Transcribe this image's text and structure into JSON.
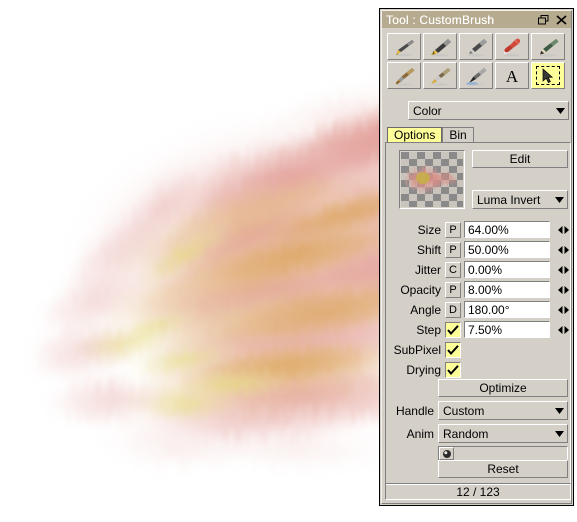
{
  "window": {
    "title": "Tool : CustomBrush",
    "restore_icon": "restore-icon",
    "close_icon": "close-icon"
  },
  "toolbar": {
    "rows": [
      [
        {
          "name": "tool-pen-nib",
          "icon": "pen-nib-icon",
          "selected": false
        },
        {
          "name": "tool-fountain-pen",
          "icon": "fountain-pen-icon",
          "selected": false
        },
        {
          "name": "tool-technical-pen",
          "icon": "technical-pen-icon",
          "selected": false
        },
        {
          "name": "tool-paintbrush",
          "icon": "paintbrush-icon",
          "selected": false
        },
        {
          "name": "tool-pencil",
          "icon": "pencil-icon",
          "selected": false
        }
      ],
      [
        {
          "name": "tool-bristle-brush",
          "icon": "bristle-brush-icon",
          "selected": false
        },
        {
          "name": "tool-flat-brush",
          "icon": "flat-brush-icon",
          "selected": false
        },
        {
          "name": "tool-ink-brush",
          "icon": "ink-brush-icon",
          "selected": false
        },
        {
          "name": "tool-text",
          "icon": "text-a-icon",
          "selected": false
        },
        {
          "name": "tool-select-cursor",
          "icon": "arrow-cursor-icon",
          "selected": true
        }
      ]
    ]
  },
  "color_select": {
    "label": "Color",
    "arrow_icon": "chevron-down-icon"
  },
  "tabs": [
    {
      "label": "Options",
      "active": true
    },
    {
      "label": "Bin",
      "active": false
    }
  ],
  "options": {
    "edit_button": "Edit",
    "blend_mode": {
      "value": "Luma Invert",
      "arrow_icon": "chevron-down-icon"
    },
    "params": [
      {
        "label": "Size",
        "mode": "P",
        "mode_type": "button",
        "value": "64.00%",
        "spinner": true
      },
      {
        "label": "Shift",
        "mode": "P",
        "mode_type": "button",
        "value": "50.00%",
        "spinner": true
      },
      {
        "label": "Jitter",
        "mode": "C",
        "mode_type": "button",
        "value": "0.00%",
        "spinner": true
      },
      {
        "label": "Opacity",
        "mode": "P",
        "mode_type": "button",
        "value": "8.00%",
        "spinner": true
      },
      {
        "label": "Angle",
        "mode": "D",
        "mode_type": "button",
        "value": "180.00°",
        "spinner": true
      },
      {
        "label": "Step",
        "mode": "checked",
        "mode_type": "checkbox",
        "value": "7.50%",
        "spinner": true
      }
    ],
    "toggles": [
      {
        "label": "SubPixel",
        "checked": true
      },
      {
        "label": "Drying",
        "checked": true
      }
    ],
    "optimize_button": "Optimize",
    "handle": {
      "label": "Handle",
      "value": "Custom",
      "arrow_icon": "chevron-down-icon"
    },
    "anim": {
      "label": "Anim",
      "value": "Random",
      "arrow_icon": "chevron-down-icon"
    },
    "anim_preview_icon": "brush-dab-icon",
    "reset_button": "Reset"
  },
  "statusbar": {
    "text": "12 / 123"
  },
  "colors": {
    "window_face": "#d4d0c8",
    "titlebar": "#b6ab8e",
    "highlight_yellow": "#ffff99",
    "field_white": "#ffffff",
    "shadow": "#808080",
    "canvas_background": "#ffffff",
    "paint_pink": "#e09a96",
    "paint_salmon": "#dd8b7e",
    "paint_gold": "#d9a64a",
    "paint_yellow": "#e3dd7a"
  }
}
